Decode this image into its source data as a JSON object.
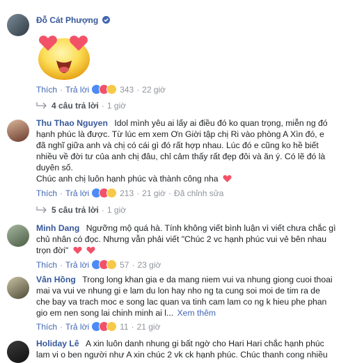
{
  "comments": [
    {
      "name": "Đỗ Cát Phượng",
      "verified": true,
      "like_label": "Thích",
      "reply_label": "Trả lời",
      "reaction_count": "343",
      "time": "22 giờ",
      "replies_label": "4 câu trả lời",
      "replies_time": "1 giờ"
    },
    {
      "name": "Thu Thao Nguyen",
      "text_lines": [
        "Idol mình yêu ai lấy ai điều đó ko quan trọng, miễn ng đó",
        "hạnh phúc là được. Từ lúc em xem Ơn Giời tập chị Ri vào phòng A Xìn đó, e",
        "đã nghĩ giữa anh và chị có cái gì đó rất hợp nhau. Lúc đó e cũng ko hề biết",
        "nhiều về đời tư của anh chị đâu, chỉ cảm thấy rất đẹp đôi và ăn ý. Có lẽ đó là",
        "duyên số."
      ],
      "text_last": "Chúc anh chị luôn hạnh phúc và thành công nha",
      "like_label": "Thích",
      "reply_label": "Trả lời",
      "reaction_count": "213",
      "time": "21 giờ",
      "edited_label": "Đã chỉnh sửa",
      "replies_label": "5 câu trả lời",
      "replies_time": "1 giờ"
    },
    {
      "name": "Minh Dang",
      "text_line1": "Ngưỡng mộ quá hà. Tính không viết bình luận vì viết chưa chắc gì",
      "text_line2": "chủ nhân có đọc. Nhưng vẫn phải viết \"Chúc 2 vc hạnh phúc vui vẻ bên nhau",
      "text_line3": "trọn đời\"",
      "like_label": "Thích",
      "reply_label": "Trả lời",
      "reaction_count": "57",
      "time": "23 giờ"
    },
    {
      "name": "Vân Hồng",
      "text_lines": [
        "Trong long khan gia e da mang niem vui va nhung giong cuoi thoai",
        "mai va vui ve nhung gi e lam du lon hay nho ng ta cung soi moi de tim ra de",
        "che bay va trach moc e song lac quan va tinh cam lam co ng k hieu phe phan"
      ],
      "text_last": "gio em nen song lai chinh minh ai l...",
      "see_more": "Xem thêm",
      "like_label": "Thích",
      "reply_label": "Trả lời",
      "reaction_count": "11",
      "time": "21 giờ"
    },
    {
      "name": "Holiday Lê",
      "text_line1": "A xin luôn danh nhung gi bất ngờ cho Hari Hari chắc hạnh phúc",
      "text_line2": "lam vi o ben người như A xin chúc 2 vk ck hạnh phúc. Chúc thanh cong nhiều"
    }
  ],
  "colors": {
    "name": "#365899",
    "link": "#4267b2",
    "muted": "#90949c",
    "heart": "#f25268"
  }
}
